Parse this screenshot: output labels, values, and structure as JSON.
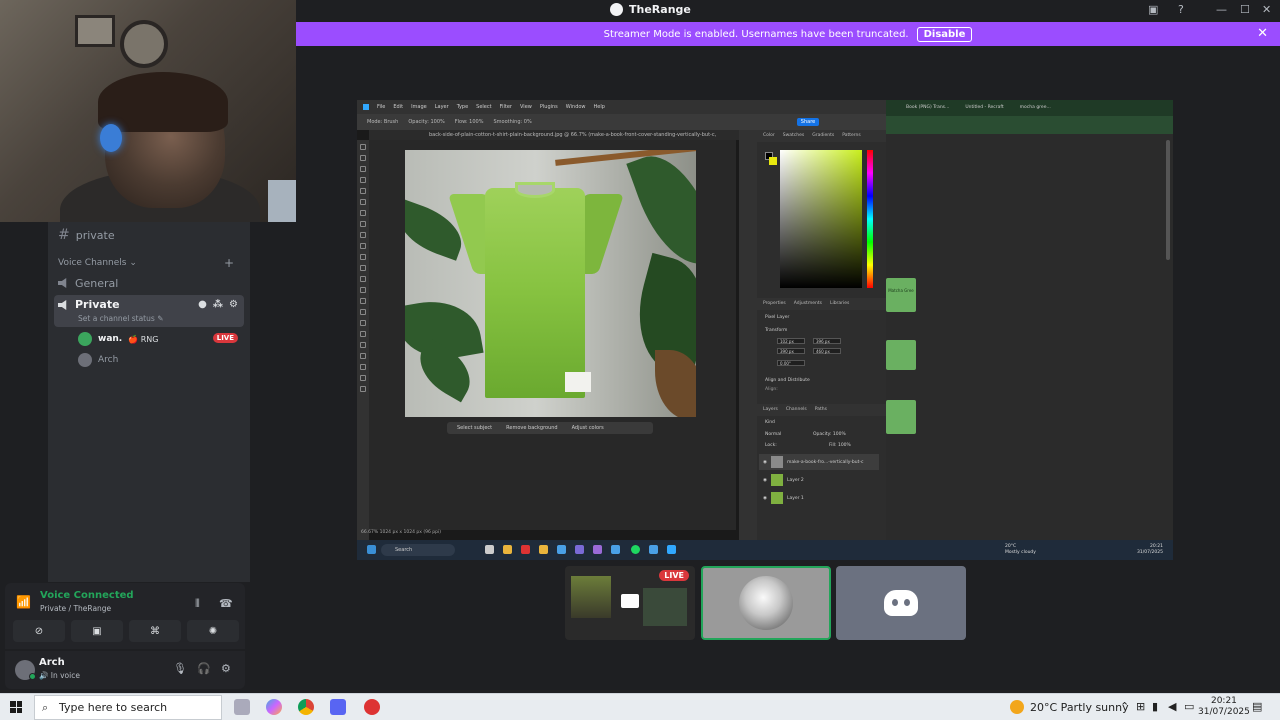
{
  "window": {
    "title": "TheRange",
    "controls": {
      "help": "?",
      "minimize": "—",
      "maximize": "☐",
      "close": "✕",
      "inbox": "▣"
    }
  },
  "banner": {
    "message": "Streamer Mode is enabled. Usernames have been truncated.",
    "action": "Disable",
    "close": "✕"
  },
  "sidebar": {
    "text_channel": "private",
    "voice_section": "Voice Channels",
    "add": "+",
    "voice_channels": [
      {
        "name": "General"
      },
      {
        "name": "Private",
        "status": "Set a channel status",
        "active": true
      }
    ],
    "members": [
      {
        "name": "wan.",
        "tag": "🍎 RNG",
        "live": "LIVE"
      },
      {
        "name": "Arch"
      }
    ]
  },
  "voice_panel": {
    "status": "Voice Connected",
    "location": "Private / TheRange",
    "buttons": [
      "camera",
      "screen-share",
      "activities",
      "soundboard"
    ]
  },
  "user_panel": {
    "name": "Arch",
    "status": "In voice"
  },
  "stream": {
    "photoshop": {
      "menu": [
        "File",
        "Edit",
        "Image",
        "Layer",
        "Type",
        "Select",
        "Filter",
        "View",
        "Plugins",
        "Window",
        "Help"
      ],
      "options": [
        "Mode: Brush",
        "Opacity: 100%",
        "Flow: 100%",
        "Smoothing: 0%"
      ],
      "share": "Share",
      "doc_tab": "back-side-of-plain-cotton-t-shirt-plain-background.jpg @ 66.7% (make-a-book-front-cover-standing-vertically-but-c, RGB/8#) *",
      "context_bar": [
        "Select subject",
        "Remove background",
        "Adjust colors"
      ],
      "status": "66.67%     1024 px x 1024 px (96 ppi)",
      "color_tabs": [
        "Color",
        "Swatches",
        "Gradients",
        "Patterns"
      ],
      "prop_tabs": [
        "Properties",
        "Adjustments",
        "Libraries"
      ],
      "pixel_layer": "Pixel Layer",
      "transform": "Transform",
      "fields": [
        "102 px",
        "396 px",
        "390 px",
        "460 px",
        "0.00°"
      ],
      "align": "Align and Distribute",
      "align_sub": "Align:",
      "layer_tabs": [
        "Layers",
        "Channels",
        "Paths"
      ],
      "layer_kind": "Kind",
      "layer_mode": "Normal",
      "layer_opacity": "Opacity: 100%",
      "layer_fill": "Fill: 100%",
      "layer_lock": "Lock:",
      "layers": [
        "make-a-book-fro...-vertically-but-c",
        "Layer 2",
        "Layer 1"
      ]
    },
    "taskbar": {
      "search": "Search",
      "weather_temp": "20°C",
      "weather_desc": "Mostly cloudy",
      "time": "20:21",
      "date": "31/07/2025"
    },
    "browser": {
      "tabs": [
        "Book (PNG) Trans...",
        "Untitled - Recraft",
        "mocha gree..."
      ],
      "card": "Matcha Gree"
    }
  },
  "thumbnails": {
    "live": "LIVE"
  },
  "taskbar": {
    "search_placeholder": "Type here to search",
    "weather": "20°C  Partly sunny",
    "time": "20:21",
    "date": "31/07/2025"
  },
  "colors": {
    "banner": "#9b4dff",
    "connected": "#23a55a",
    "live": "#da373c",
    "sidebar": "#2b2d31"
  }
}
